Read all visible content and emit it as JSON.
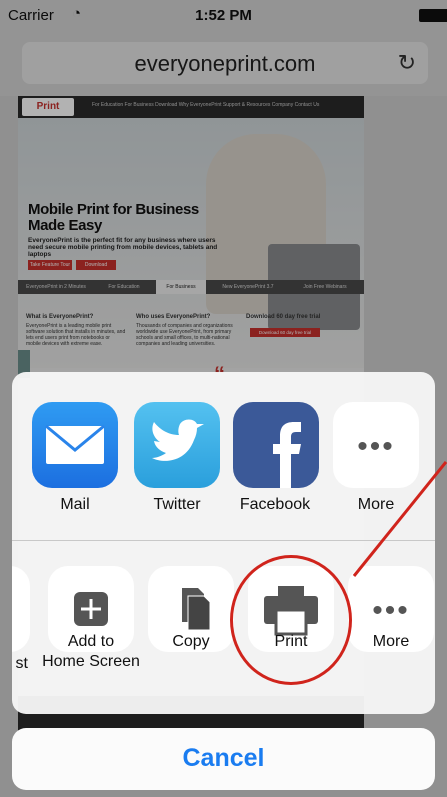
{
  "statusbar": {
    "carrier": "Carrier",
    "time": "1:52 PM"
  },
  "browser": {
    "url": "everyoneprint.com"
  },
  "website": {
    "logo": "Print",
    "nav": "For Education   For Business   Download   Why EveryonePrint   Support & Resources   Company   Contact Us",
    "hero_title": "Mobile Print for Business Made Easy",
    "hero_subtitle": "EveryonePrint is the perfect fit for any business where users need secure mobile printing from mobile devices, tablets and laptops",
    "hero_button_1": "Take Feature Tour",
    "hero_button_2": "Download",
    "tabs": [
      "EveryonePrint in 2 Minutes",
      "For Education",
      "For Business",
      "New EveryonePrint 3.7",
      "Join Free Webinars"
    ],
    "col1_title": "What is EveryonePrint?",
    "col1_text": "EveryonePrint is a leading mobile print software solution that installs in minutes, and lets end users print from notebooks or mobile devices with extreme ease.",
    "col2_title": "Who uses EveryonePrint?",
    "col2_text": "Thousands of companies and organizations worldwide use EveryonePrint, from primary schools and small offices, to multi-national companies and leading universities.",
    "col3_title": "Download 60 day free trial",
    "col3_button": "Download 60 day free trial"
  },
  "share_sheet": {
    "apps": [
      {
        "label": "Mail",
        "icon": "mail-icon"
      },
      {
        "label": "Twitter",
        "icon": "twitter-icon"
      },
      {
        "label": "Facebook",
        "icon": "facebook-icon"
      },
      {
        "label": "More",
        "icon": "more-dots-icon"
      }
    ],
    "actions": [
      {
        "label": "st",
        "icon": "partial-icon"
      },
      {
        "label": "Add to\nHome Screen",
        "icon": "add-plus-icon"
      },
      {
        "label": "Copy",
        "icon": "copy-icon"
      },
      {
        "label": "Print",
        "icon": "print-icon"
      },
      {
        "label": "More",
        "icon": "more-dots-icon"
      }
    ],
    "cancel": "Cancel"
  },
  "colors": {
    "accent": "#1a7cf0",
    "annotation": "#d0241c",
    "brand_red": "#c8312d"
  }
}
